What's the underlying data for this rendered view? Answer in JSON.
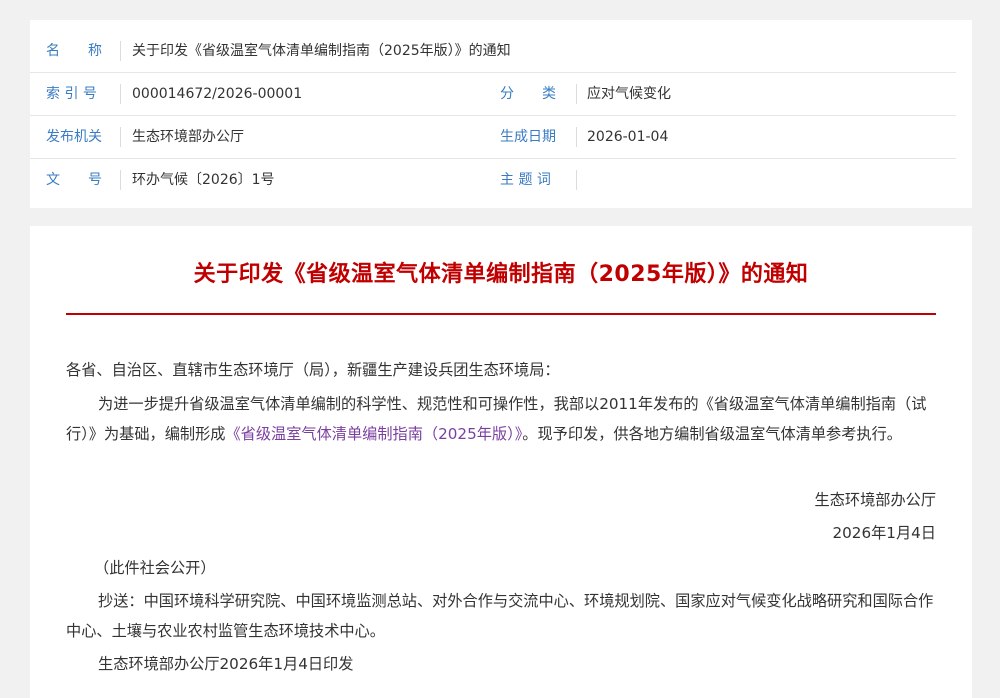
{
  "meta": {
    "name_label": "名　　称",
    "name_value": "关于印发《省级温室气体清单编制指南（2025年版）》的通知",
    "index_label": "索 引 号",
    "index_value": "000014672/2026-00001",
    "category_label": "分　　类",
    "category_value": "应对气候变化",
    "issuer_label": "发布机关",
    "issuer_value": "生态环境部办公厅",
    "date_label": "生成日期",
    "date_value": "2026-01-04",
    "docno_label": "文　　号",
    "docno_value": "环办气候〔2026〕1号",
    "topic_label": "主 题 词",
    "topic_value": ""
  },
  "document": {
    "title": "关于印发《省级温室气体清单编制指南（2025年版）》的通知",
    "salutation": "各省、自治区、直辖市生态环境厅（局），新疆生产建设兵团生态环境局：",
    "body_before_link": "为进一步提升省级温室气体清单编制的科学性、规范性和可操作性，我部以2011年发布的《省级温室气体清单编制指南（试行）》为基础，编制形成",
    "body_link": "《省级温室气体清单编制指南（2025年版）》",
    "body_after_link": "。现予印发，供各地方编制省级温室气体清单参考执行。",
    "signature_org": "生态环境部办公厅",
    "signature_date": "2026年1月4日",
    "public_note": "（此件社会公开）",
    "cc": "抄送：中国环境科学研究院、中国环境监测总站、对外合作与交流中心、环境规划院、国家应对气候变化战略研究和国际合作中心、土壤与农业农村监管生态环境技术中心。",
    "print_note": "生态环境部办公厅2026年1月4日印发"
  }
}
